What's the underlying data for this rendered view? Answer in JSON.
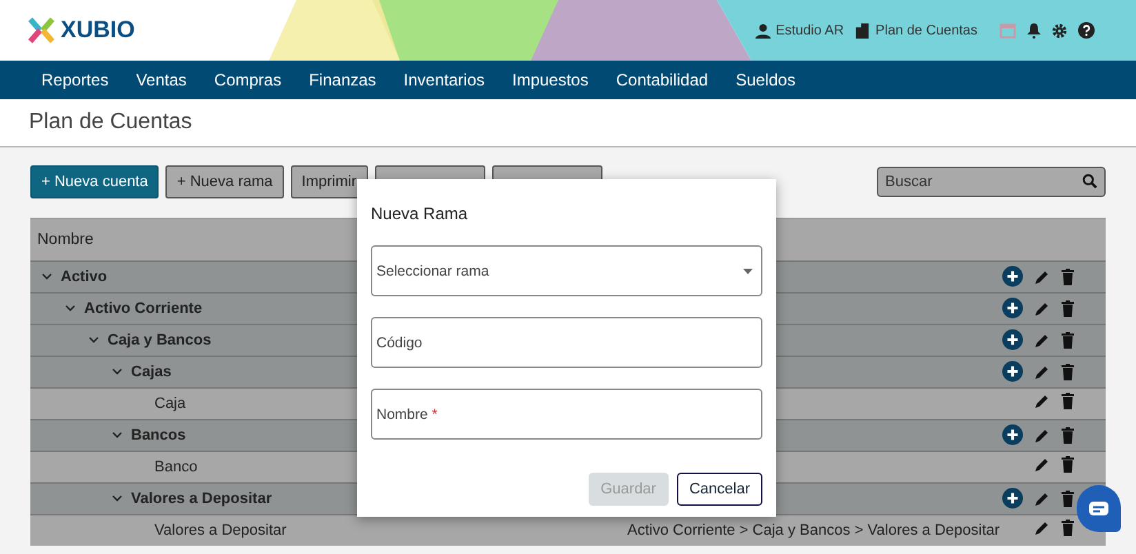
{
  "header": {
    "logo": "XUBIO",
    "account": "Estudio AR",
    "section": "Plan de Cuentas"
  },
  "nav": [
    {
      "label": "Reportes"
    },
    {
      "label": "Ventas"
    },
    {
      "label": "Compras"
    },
    {
      "label": "Finanzas"
    },
    {
      "label": "Inventarios"
    },
    {
      "label": "Impuestos"
    },
    {
      "label": "Contabilidad"
    },
    {
      "label": "Sueldos"
    }
  ],
  "page_title": "Plan de Cuentas",
  "toolbar": {
    "buttons": [
      {
        "label": "+ Nueva cuenta",
        "kind": "primary"
      },
      {
        "label": "+ Nueva rama",
        "kind": "outline"
      },
      {
        "label": "Imprimir",
        "kind": "outline"
      },
      {
        "kind": "outline"
      },
      {
        "kind": "outline"
      }
    ],
    "search": {
      "placeholder": "Buscar"
    }
  },
  "table": {
    "columns": [
      {
        "label": "Nombre"
      }
    ],
    "rows": [
      {
        "name": "Activo",
        "expanded": true,
        "children": [
          {
            "name": "Activo Corriente",
            "expanded": true,
            "children": [
              {
                "name": "Caja y Bancos",
                "expanded": true,
                "children": [
                  {
                    "name": "Cajas",
                    "expanded": true,
                    "children": [
                      {
                        "name": "Caja"
                      }
                    ]
                  },
                  {
                    "name": "Bancos",
                    "expanded": true,
                    "children": [
                      {
                        "name": "Banco"
                      }
                    ]
                  },
                  {
                    "name": "Valores a Depositar",
                    "expanded": true,
                    "children": [
                      {
                        "name": "Valores a Depositar",
                        "path": "Activo Corriente > Caja y Bancos > Valores a Depositar"
                      }
                    ]
                  }
                ]
              }
            ]
          }
        ]
      }
    ]
  },
  "modal": {
    "title": "Nueva Rama",
    "fields": [
      {
        "kind": "select",
        "placeholder": "Seleccionar rama"
      },
      {
        "kind": "text",
        "placeholder": "Código"
      },
      {
        "kind": "text",
        "placeholder": "Nombre",
        "required_mark": "*"
      }
    ],
    "buttons": [
      {
        "label": "Guardar",
        "disabled": true
      },
      {
        "label": "Cancelar",
        "disabled": false
      }
    ]
  }
}
